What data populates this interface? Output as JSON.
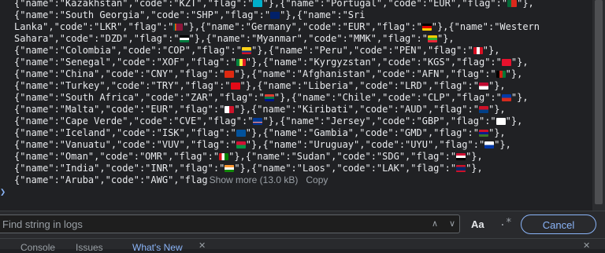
{
  "console": {
    "lines": [
      [
        {
          "t": "{\"name\":\"Kazakhstan\",\"code\":\"KZT\",\"flag\":\""
        },
        {
          "f": "KZ"
        },
        {
          "t": "\"},{\"name\":\"Portugal\",\"code\":\"EUR\",\"flag\":\""
        },
        {
          "f": "PT"
        },
        {
          "t": "\"},"
        }
      ],
      [
        {
          "t": "{\"name\":\"South Georgia\",\"code\":\"SHP\",\"flag\":\""
        },
        {
          "f": "GS"
        },
        {
          "t": "\"},{\"name\":\"Sri"
        }
      ],
      [
        {
          "t": "Lanka\",\"code\":\"LKR\",\"flag\":\""
        },
        {
          "f": "LK"
        },
        {
          "t": "\"},{\"name\":\"Germany\",\"code\":\"EUR\",\"flag\":\""
        },
        {
          "f": "DE"
        },
        {
          "t": "\"},{\"name\":\"Western"
        }
      ],
      [
        {
          "t": "Sahara\",\"code\":\"DZD\",\"flag\":\""
        },
        {
          "f": "EH"
        },
        {
          "t": "\"},{\"name\":\"Myanmar\",\"code\":\"MMK\",\"flag\":\""
        },
        {
          "f": "MM"
        },
        {
          "t": "\"},"
        }
      ],
      [
        {
          "t": "{\"name\":\"Colombia\",\"code\":\"COP\",\"flag\":\""
        },
        {
          "f": "CO"
        },
        {
          "t": "\"},{\"name\":\"Peru\",\"code\":\"PEN\",\"flag\":\""
        },
        {
          "f": "PE"
        },
        {
          "t": "\"},"
        }
      ],
      [
        {
          "t": "{\"name\":\"Senegal\",\"code\":\"XOF\",\"flag\":\""
        },
        {
          "f": "SN"
        },
        {
          "t": "\"},{\"name\":\"Kyrgyzstan\",\"code\":\"KGS\",\"flag\":\""
        },
        {
          "f": "KG"
        },
        {
          "t": "\"},"
        }
      ],
      [
        {
          "t": "{\"name\":\"China\",\"code\":\"CNY\",\"flag\":\""
        },
        {
          "f": "CN"
        },
        {
          "t": "\"},{\"name\":\"Afghanistan\",\"code\":\"AFN\",\"flag\":\""
        },
        {
          "f": "AF"
        },
        {
          "t": "\"},"
        }
      ],
      [
        {
          "t": "{\"name\":\"Turkey\",\"code\":\"TRY\",\"flag\":\""
        },
        {
          "f": "TR"
        },
        {
          "t": "\"},{\"name\":\"Liberia\",\"code\":\"LRD\",\"flag\":\""
        },
        {
          "f": "LR"
        },
        {
          "t": "\"},"
        }
      ],
      [
        {
          "t": "{\"name\":\"South Africa\",\"code\":\"ZAR\",\"flag\":\""
        },
        {
          "f": "ZA"
        },
        {
          "t": "\"},{\"name\":\"Chile\",\"code\":\"CLP\",\"flag\":\""
        },
        {
          "f": "CL"
        },
        {
          "t": "\"},"
        }
      ],
      [
        {
          "t": "{\"name\":\"Malta\",\"code\":\"EUR\",\"flag\":\""
        },
        {
          "f": "MT"
        },
        {
          "t": "\"},{\"name\":\"Kiribati\",\"code\":\"AUD\",\"flag\":\""
        },
        {
          "f": "KI"
        },
        {
          "t": "\"},"
        }
      ],
      [
        {
          "t": "{\"name\":\"Cape Verde\",\"code\":\"CVE\",\"flag\":\""
        },
        {
          "f": "CV"
        },
        {
          "t": "\"},{\"name\":\"Jersey\",\"code\":\"GBP\",\"flag\":\""
        },
        {
          "f": "JE"
        },
        {
          "t": "\"},"
        }
      ],
      [
        {
          "t": "{\"name\":\"Iceland\",\"code\":\"ISK\",\"flag\":\""
        },
        {
          "f": "IS"
        },
        {
          "t": "\"},{\"name\":\"Gambia\",\"code\":\"GMD\",\"flag\":\""
        },
        {
          "f": "GM"
        },
        {
          "t": "\"},"
        }
      ],
      [
        {
          "t": "{\"name\":\"Vanuatu\",\"code\":\"VUV\",\"flag\":\""
        },
        {
          "f": "VU"
        },
        {
          "t": "\"},{\"name\":\"Uruguay\",\"code\":\"UYU\",\"flag\":\""
        },
        {
          "f": "UY"
        },
        {
          "t": "\"},"
        }
      ],
      [
        {
          "t": "{\"name\":\"Oman\",\"code\":\"OMR\",\"flag\":\""
        },
        {
          "f": "OM"
        },
        {
          "t": "\"},{\"name\":\"Sudan\",\"code\":\"SDG\",\"flag\":\""
        },
        {
          "f": "SD"
        },
        {
          "t": "\"},"
        }
      ],
      [
        {
          "t": "{\"name\":\"India\",\"code\":\"INR\",\"flag\":\""
        },
        {
          "f": "IN"
        },
        {
          "t": "\"},{\"name\":\"Laos\",\"code\":\"LAK\",\"flag\":\""
        },
        {
          "f": "LA"
        },
        {
          "t": "\"},"
        }
      ],
      [
        {
          "t": "{\"name\":\"Aruba\",\"code\":\"AWG\",\"flag"
        },
        {
          "more": true
        }
      ]
    ],
    "show_more_label": "Show more (13.0 kB)",
    "copy_label": "Copy",
    "prompt_icon": "chevron-right-icon"
  },
  "flag_colors": {
    "KZ": "linear-gradient(#00afca,#00afca)",
    "PT": "linear-gradient(90deg,#046a38 40%,#da291c 40%)",
    "GS": "linear-gradient(#012169,#012169)",
    "LK": "linear-gradient(90deg,#00534e 15%,#eb7400 15%,#eb7400 30%,#8d153a 30%)",
    "DE": "linear-gradient(#000 33%,#dd0000 33%,#dd0000 66%,#ffce00 66%)",
    "EH": "linear-gradient(#000 33%,#fff 33%,#fff 66%,#007a3d 66%)",
    "MM": "linear-gradient(#fecb00 33%,#34b233 33%,#34b233 66%,#ea2839 66%)",
    "CO": "linear-gradient(#fcd116 50%,#003893 50%,#003893 75%,#ce1126 75%)",
    "PE": "linear-gradient(90deg,#d91023 33%,#fff 33%,#fff 66%,#d91023 66%)",
    "SN": "linear-gradient(90deg,#00853f 33%,#fdef42 33%,#fdef42 66%,#e31b23 66%)",
    "KG": "linear-gradient(#e8112d,#e8112d)",
    "CN": "linear-gradient(#de2910,#de2910)",
    "AF": "linear-gradient(90deg,#000 33%,#d32011 33%,#d32011 66%,#007a36 66%)",
    "TR": "linear-gradient(#e30a17,#e30a17)",
    "LR": "linear-gradient(#bf0a30 50%,#fff 50%)",
    "ZA": "linear-gradient(#e03c31 33%,#007749 33%,#007749 66%,#001489 66%)",
    "CL": "linear-gradient(#0039a6 50%,#d52b1e 50%)",
    "MT": "linear-gradient(90deg,#fff 50%,#cf142b 50%)",
    "KI": "linear-gradient(#ce1126 50%,#003f87 50%)",
    "CV": "linear-gradient(#003893 55%,#fff 55%,#cf2027 70%,#003893 70%)",
    "JE": "linear-gradient(#fff,#fff)",
    "IS": "linear-gradient(#02529c,#02529c)",
    "GM": "linear-gradient(#ce1126 33%,#0c1c8c 33%,#0c1c8c 66%,#3a7728 66%)",
    "VU": "linear-gradient(#d21034 50%,#009543 50%)",
    "UY": "linear-gradient(#fff 50%,#0038a8 50%)",
    "OM": "linear-gradient(90deg,#db161b 30%,#fff 30%,#fff 60%,#008000 60%)",
    "SD": "linear-gradient(#d21034 33%,#fff 33%,#fff 66%,#000 66%)",
    "IN": "linear-gradient(#ff9933 33%,#fff 33%,#fff 66%,#138808 66%)",
    "LA": "linear-gradient(#ce1126 25%,#002868 25%,#002868 75%,#ce1126 75%)"
  },
  "search": {
    "placeholder": "Find string in logs",
    "value": ""
  },
  "toolbar": {
    "up_icon": "chevron-up-icon",
    "down_icon": "chevron-down-icon",
    "match_case_label": "Aa",
    "regex_label": ".*",
    "cancel_label": "Cancel"
  },
  "tabs": {
    "items": [
      "Console",
      "Issues",
      "What's New"
    ],
    "active": "What's New"
  }
}
